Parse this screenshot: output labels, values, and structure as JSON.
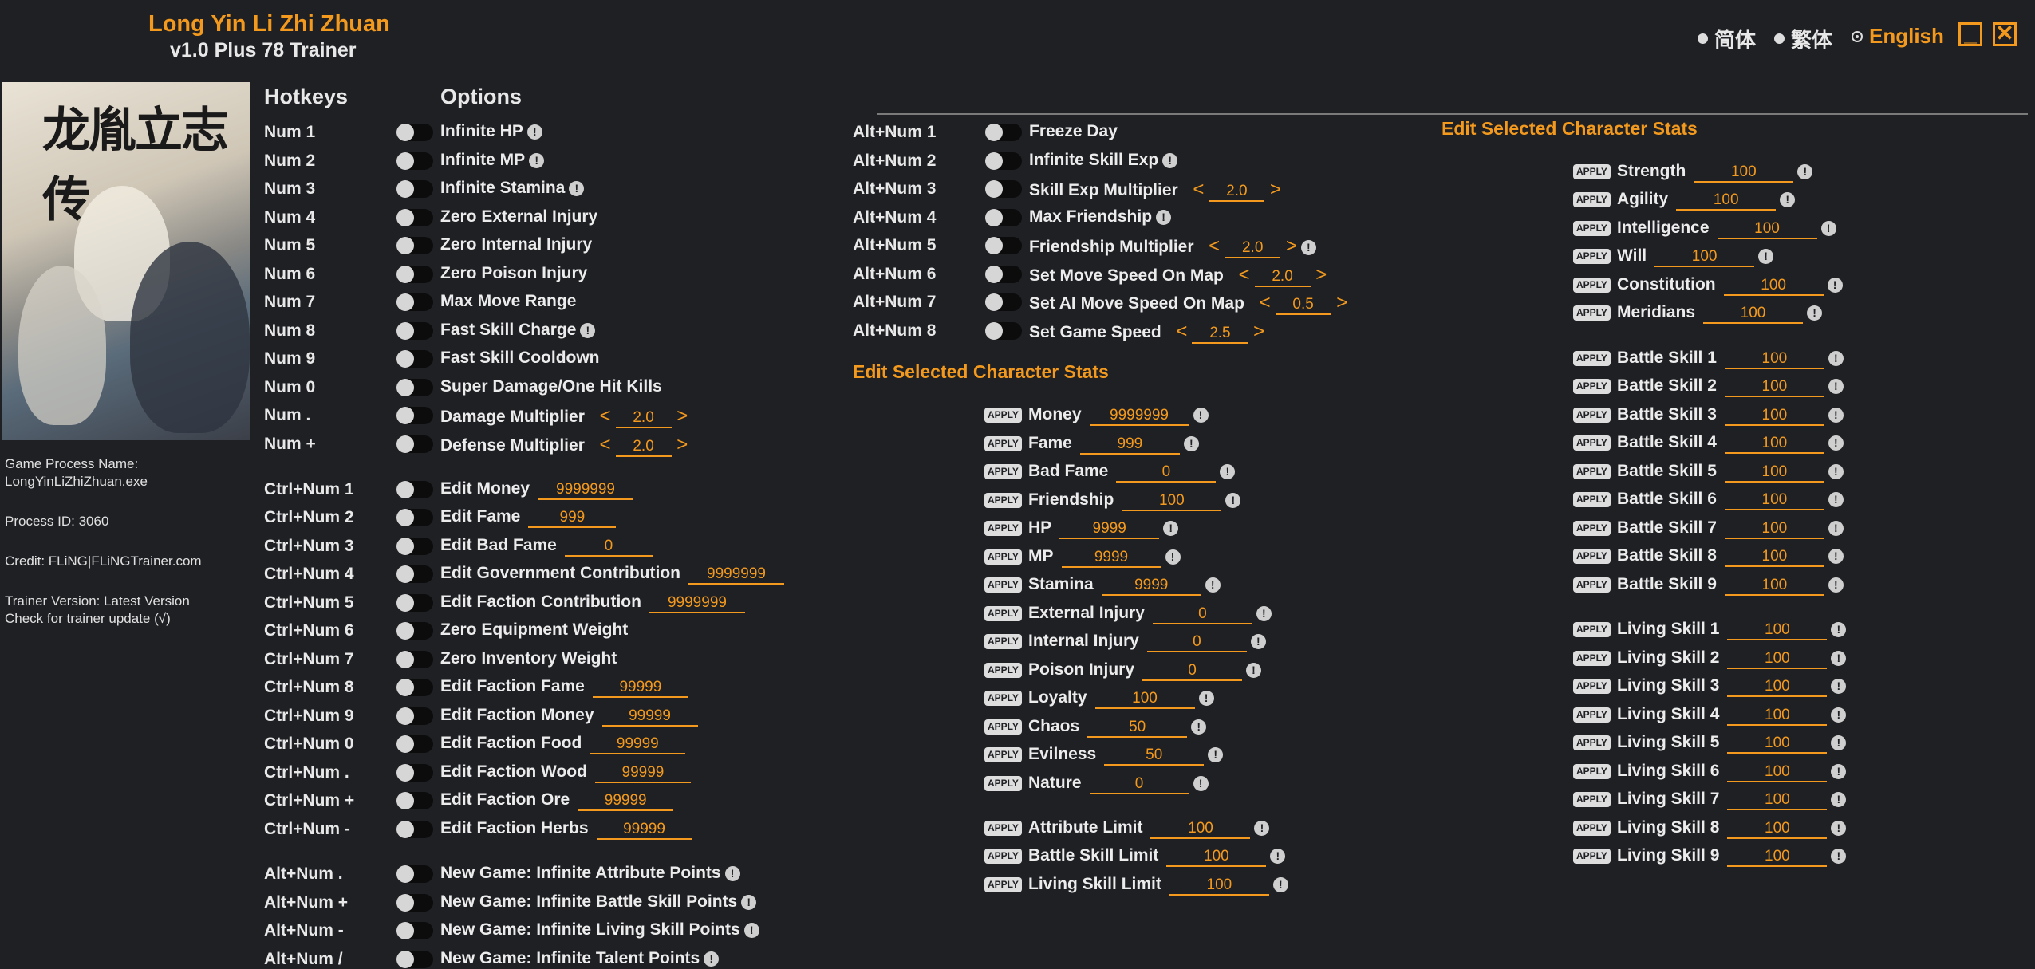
{
  "app": {
    "title": "Long Yin Li Zhi Zhuan",
    "subtitle": "v1.0 Plus 78 Trainer"
  },
  "lang": {
    "simplified": "简体",
    "traditional": "繁体",
    "english": "English"
  },
  "colors": {
    "accent": "#f39a1e",
    "bg": "#1f2024"
  },
  "cover": {
    "logo": "龙胤立志传"
  },
  "info": {
    "process_label": "Game Process Name:",
    "process_name": "LongYinLiZhiZhuan.exe",
    "pid": "Process ID: 3060",
    "credit": "Credit: FLiNG|FLiNGTrainer.com",
    "version": "Trainer Version: Latest Version",
    "update": "Check for trainer update (√)"
  },
  "headers": {
    "hotkeys": "Hotkeys",
    "options": "Options"
  },
  "col1": [
    {
      "k": "Num 1",
      "l": "Infinite HP",
      "i": true
    },
    {
      "k": "Num 2",
      "l": "Infinite MP",
      "i": true
    },
    {
      "k": "Num 3",
      "l": "Infinite Stamina",
      "i": true
    },
    {
      "k": "Num 4",
      "l": "Zero External Injury"
    },
    {
      "k": "Num 5",
      "l": "Zero Internal Injury"
    },
    {
      "k": "Num 6",
      "l": "Zero Poison Injury"
    },
    {
      "k": "Num 7",
      "l": "Max Move Range"
    },
    {
      "k": "Num 8",
      "l": "Fast Skill Charge",
      "i": true
    },
    {
      "k": "Num 9",
      "l": "Fast Skill Cooldown"
    },
    {
      "k": "Num 0",
      "l": "Super Damage/One Hit Kills"
    },
    {
      "k": "Num .",
      "l": "Damage Multiplier",
      "m": "2.0"
    },
    {
      "k": "Num +",
      "l": "Defense Multiplier",
      "m": "2.0"
    },
    {
      "k": "Ctrl+Num 1",
      "l": "Edit Money",
      "v": "9999999"
    },
    {
      "k": "Ctrl+Num 2",
      "l": "Edit Fame",
      "v": "999"
    },
    {
      "k": "Ctrl+Num 3",
      "l": "Edit Bad Fame",
      "v": "0"
    },
    {
      "k": "Ctrl+Num 4",
      "l": "Edit Government Contribution",
      "v": "9999999"
    },
    {
      "k": "Ctrl+Num 5",
      "l": "Edit Faction Contribution",
      "v": "9999999"
    },
    {
      "k": "Ctrl+Num 6",
      "l": "Zero Equipment Weight"
    },
    {
      "k": "Ctrl+Num 7",
      "l": "Zero Inventory Weight"
    },
    {
      "k": "Ctrl+Num 8",
      "l": "Edit Faction Fame",
      "v": "99999"
    },
    {
      "k": "Ctrl+Num 9",
      "l": "Edit Faction Money",
      "v": "99999"
    },
    {
      "k": "Ctrl+Num 0",
      "l": "Edit Faction Food",
      "v": "99999"
    },
    {
      "k": "Ctrl+Num .",
      "l": "Edit Faction Wood",
      "v": "99999"
    },
    {
      "k": "Ctrl+Num +",
      "l": "Edit Faction Ore",
      "v": "99999"
    },
    {
      "k": "Ctrl+Num -",
      "l": "Edit Faction Herbs",
      "v": "99999"
    },
    {
      "k": "Alt+Num .",
      "l": "New Game: Infinite Attribute Points",
      "i": true
    },
    {
      "k": "Alt+Num +",
      "l": "New Game: Infinite Battle Skill Points",
      "i": true
    },
    {
      "k": "Alt+Num -",
      "l": "New Game: Infinite Living Skill Points",
      "i": true
    },
    {
      "k": "Alt+Num /",
      "l": "New Game: Infinite Talent Points",
      "i": true
    }
  ],
  "col2": [
    {
      "k": "Alt+Num 1",
      "l": "Freeze Day"
    },
    {
      "k": "Alt+Num 2",
      "l": "Infinite Skill Exp",
      "i": true
    },
    {
      "k": "Alt+Num 3",
      "l": "Skill Exp Multiplier",
      "m": "2.0"
    },
    {
      "k": "Alt+Num 4",
      "l": "Max Friendship",
      "i": true
    },
    {
      "k": "Alt+Num 5",
      "l": "Friendship Multiplier",
      "m": "2.0",
      "i": true
    },
    {
      "k": "Alt+Num 6",
      "l": "Set Move Speed On Map",
      "m": "2.0"
    },
    {
      "k": "Alt+Num 7",
      "l": "Set AI Move Speed On Map",
      "m": "0.5"
    },
    {
      "k": "Alt+Num 8",
      "l": "Set Game Speed",
      "m": "2.5"
    }
  ],
  "sec_title": "Edit Selected Character Stats",
  "apply": "APPLY",
  "stats2": [
    {
      "l": "Money",
      "v": "9999999"
    },
    {
      "l": "Fame",
      "v": "999"
    },
    {
      "l": "Bad Fame",
      "v": "0"
    },
    {
      "l": "Friendship",
      "v": "100"
    },
    {
      "l": "HP",
      "v": "9999"
    },
    {
      "l": "MP",
      "v": "9999"
    },
    {
      "l": "Stamina",
      "v": "9999"
    },
    {
      "l": "External Injury",
      "v": "0"
    },
    {
      "l": "Internal Injury",
      "v": "0"
    },
    {
      "l": "Poison Injury",
      "v": "0"
    },
    {
      "l": "Loyalty",
      "v": "100"
    },
    {
      "l": "Chaos",
      "v": "50"
    },
    {
      "l": "Evilness",
      "v": "50"
    },
    {
      "l": "Nature",
      "v": "0"
    },
    {
      "l": "Attribute Limit",
      "v": "100"
    },
    {
      "l": "Battle Skill Limit",
      "v": "100"
    },
    {
      "l": "Living Skill Limit",
      "v": "100"
    }
  ],
  "stats3": [
    {
      "l": "Strength",
      "v": "100"
    },
    {
      "l": "Agility",
      "v": "100"
    },
    {
      "l": "Intelligence",
      "v": "100"
    },
    {
      "l": "Will",
      "v": "100"
    },
    {
      "l": "Constitution",
      "v": "100"
    },
    {
      "l": "Meridians",
      "v": "100"
    },
    {
      "l": "Battle Skill 1",
      "v": "100"
    },
    {
      "l": "Battle Skill 2",
      "v": "100"
    },
    {
      "l": "Battle Skill 3",
      "v": "100"
    },
    {
      "l": "Battle Skill 4",
      "v": "100"
    },
    {
      "l": "Battle Skill 5",
      "v": "100"
    },
    {
      "l": "Battle Skill 6",
      "v": "100"
    },
    {
      "l": "Battle Skill 7",
      "v": "100"
    },
    {
      "l": "Battle Skill 8",
      "v": "100"
    },
    {
      "l": "Battle Skill 9",
      "v": "100"
    },
    {
      "l": "Living Skill 1",
      "v": "100"
    },
    {
      "l": "Living Skill 2",
      "v": "100"
    },
    {
      "l": "Living Skill 3",
      "v": "100"
    },
    {
      "l": "Living Skill 4",
      "v": "100"
    },
    {
      "l": "Living Skill 5",
      "v": "100"
    },
    {
      "l": "Living Skill 6",
      "v": "100"
    },
    {
      "l": "Living Skill 7",
      "v": "100"
    },
    {
      "l": "Living Skill 8",
      "v": "100"
    },
    {
      "l": "Living Skill 9",
      "v": "100"
    }
  ]
}
